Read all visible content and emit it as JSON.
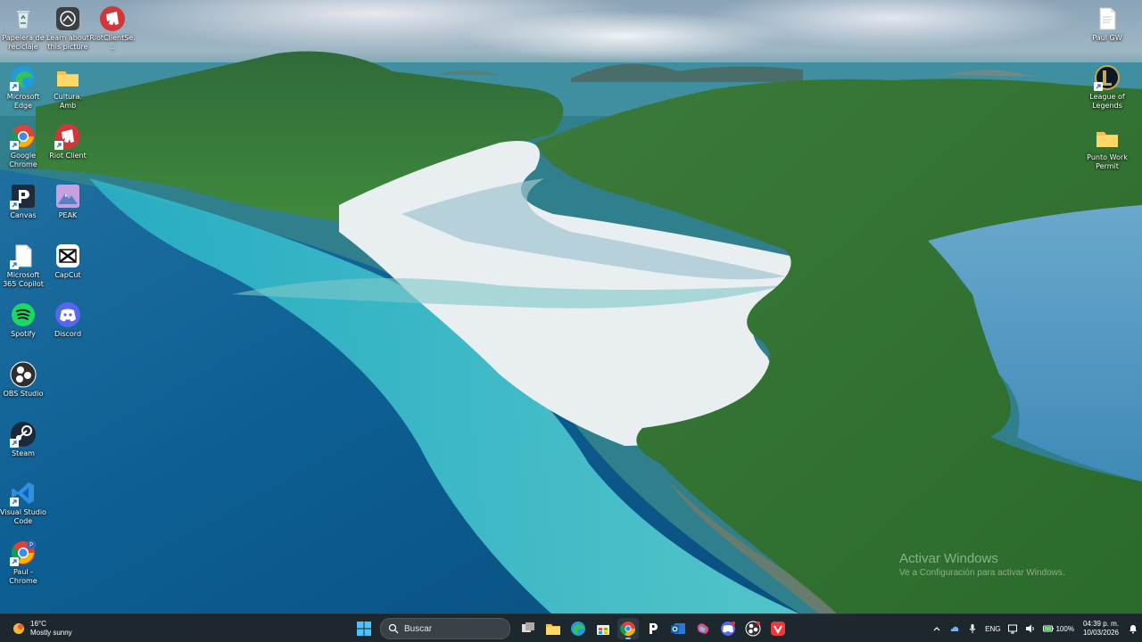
{
  "desktop": {
    "left_icons": [
      {
        "label": "Papelera de reciclaje",
        "icon": "recycle-bin-icon"
      },
      {
        "label": "Learn about this picture",
        "icon": "learn-icon"
      },
      {
        "label": "RiotClientSe...",
        "icon": "riot-icon"
      },
      {
        "label": "Microsoft Edge",
        "icon": "edge-icon"
      },
      {
        "label": "Cultura. Amb",
        "icon": "folder-icon"
      },
      {
        "label": "Google Chrome",
        "icon": "chrome-icon"
      },
      {
        "label": "Riot Client",
        "icon": "riot-icon"
      },
      {
        "label": "Canvas",
        "icon": "canvas-icon"
      },
      {
        "label": "PEAK",
        "icon": "peak-icon"
      },
      {
        "label": "Microsoft 365 Copilot",
        "icon": "document-icon"
      },
      {
        "label": "CapCut",
        "icon": "capcut-icon"
      },
      {
        "label": "Spotify",
        "icon": "spotify-icon"
      },
      {
        "label": "Discord",
        "icon": "discord-icon"
      },
      {
        "label": "OBS Studio",
        "icon": "obs-icon"
      },
      {
        "label": "Steam",
        "icon": "steam-icon"
      },
      {
        "label": "Visual Studio Code",
        "icon": "vscode-icon"
      },
      {
        "label": "Paul - Chrome",
        "icon": "chrome-profile-icon"
      }
    ],
    "right_icons": [
      {
        "label": "Paul GW",
        "icon": "document-icon"
      },
      {
        "label": "League of Legends",
        "icon": "league-icon"
      },
      {
        "label": "Punto Work Permit",
        "icon": "folder-icon"
      }
    ]
  },
  "watermark": {
    "title": "Activar Windows",
    "subtitle": "Ve a Configuración para activar Windows."
  },
  "taskbar": {
    "weather_temp": "16°C",
    "weather_desc": "Mostly sunny",
    "search_placeholder": "Buscar",
    "language": "ENG",
    "battery": "100%",
    "time": "04:39 p. m.",
    "date": "10/03/2026"
  },
  "colors": {
    "taskbar_bg": "#1c2126",
    "accent": "#7cc4ff"
  }
}
